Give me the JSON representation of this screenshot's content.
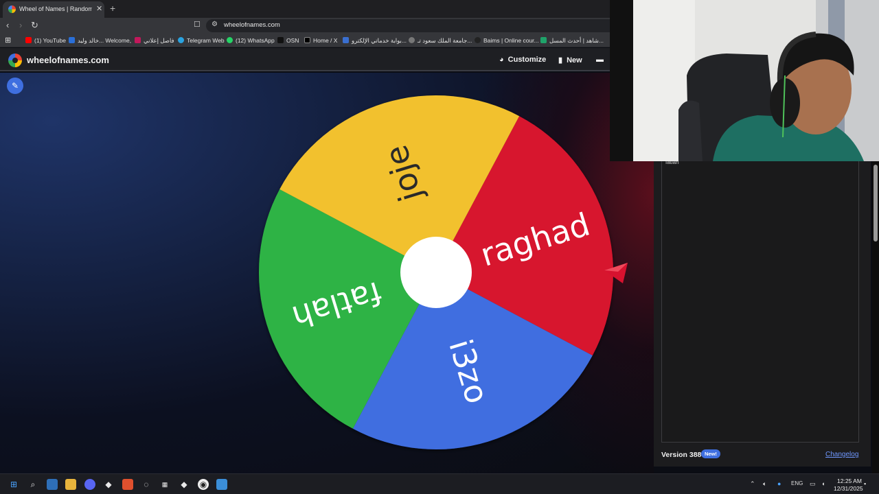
{
  "browser": {
    "tab_title": "Wheel of Names | Random name picker",
    "url": "wheelofnames.com",
    "bookmarks": [
      {
        "label": "(1) YouTube",
        "color": "#ff0000"
      },
      {
        "label": "خالد وليد... Welcome,",
        "color": "#2a6fd8"
      },
      {
        "label": "فاصل إعلاني",
        "color": "#c2185b"
      },
      {
        "label": "Telegram Web",
        "color": "#2aa3e0"
      },
      {
        "label": "(12) WhatsApp",
        "color": "#25d366"
      },
      {
        "label": "OSN",
        "color": "#111111"
      },
      {
        "label": "Home / X",
        "color": "#000000"
      },
      {
        "label": "بوابة خدماتي الإلكترو...",
        "color": "#3a6fd0"
      },
      {
        "label": "جامعة الملك سعود تـ...",
        "color": "#777777"
      },
      {
        "label": "Baims | Online cour...",
        "color": "#222222"
      },
      {
        "label": "شاهد | أحدث المسل...",
        "color": "#1fa36a"
      }
    ]
  },
  "site": {
    "name": "wheelofnames.com",
    "customize_label": "Customize",
    "new_label": "New"
  },
  "wheel": {
    "segments": [
      {
        "label": "raghad",
        "color": "#d7122f"
      },
      {
        "label": "i3zo",
        "color": "#3f6ee0"
      },
      {
        "label": "fatlah",
        "color": "#2fb344"
      },
      {
        "label": "joje",
        "color": "#f2c12e"
      }
    ],
    "pointer_color": "#d7122f"
  },
  "panel": {
    "entry_peek": "fatlah",
    "version": "Version 388",
    "new_badge": "New!",
    "changelog": "Changelog"
  },
  "taskbar": {
    "lang": "ENG",
    "time": "12:25 AM",
    "date": "12/31/2025"
  }
}
